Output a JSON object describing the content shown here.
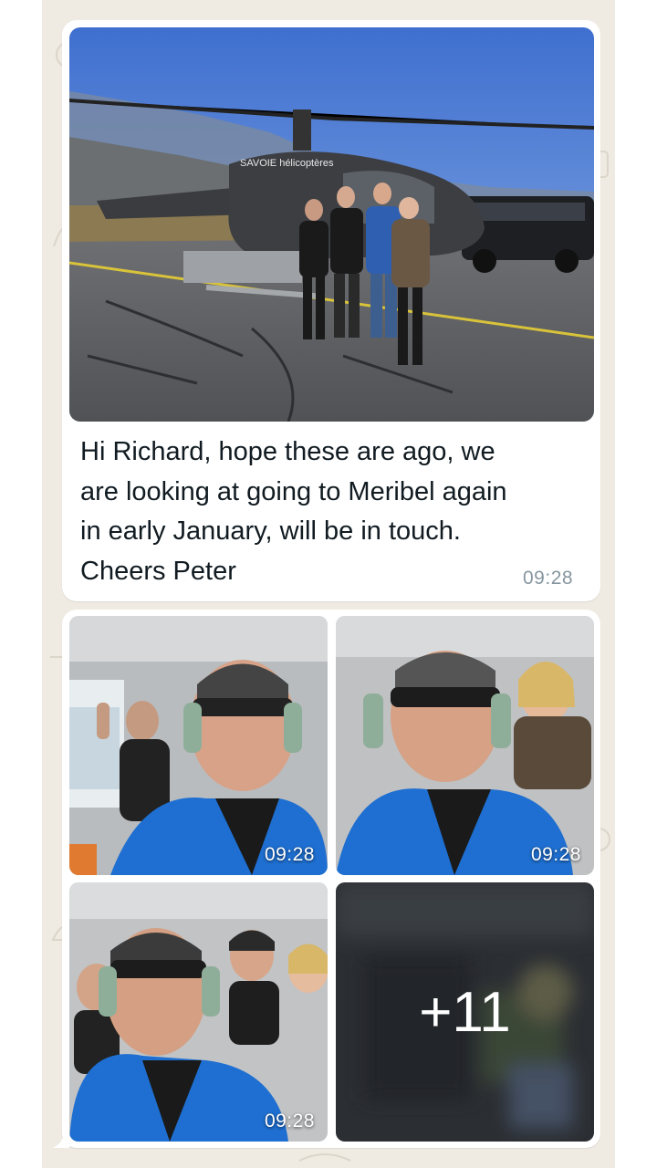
{
  "message": {
    "text": "Hi Richard, hope these are ago, we\nare looking at going to Meribel again\nin early January, will be in touch.\nCheers Peter",
    "time": "09:28",
    "image_alt": "helicopter-group-photo",
    "helicopter_logo": "SAVOIE hélicoptères"
  },
  "album": {
    "items": [
      {
        "time": "09:28",
        "image": "selfie-cockpit-1"
      },
      {
        "time": "09:28",
        "image": "selfie-cockpit-2"
      },
      {
        "time": "09:28",
        "image": "selfie-cockpit-3"
      }
    ],
    "more_count": "+11"
  },
  "colors": {
    "chat_background": "#efeae2",
    "bubble": "#ffffff",
    "text": "#111b21",
    "timestamp": "#8696a0"
  }
}
